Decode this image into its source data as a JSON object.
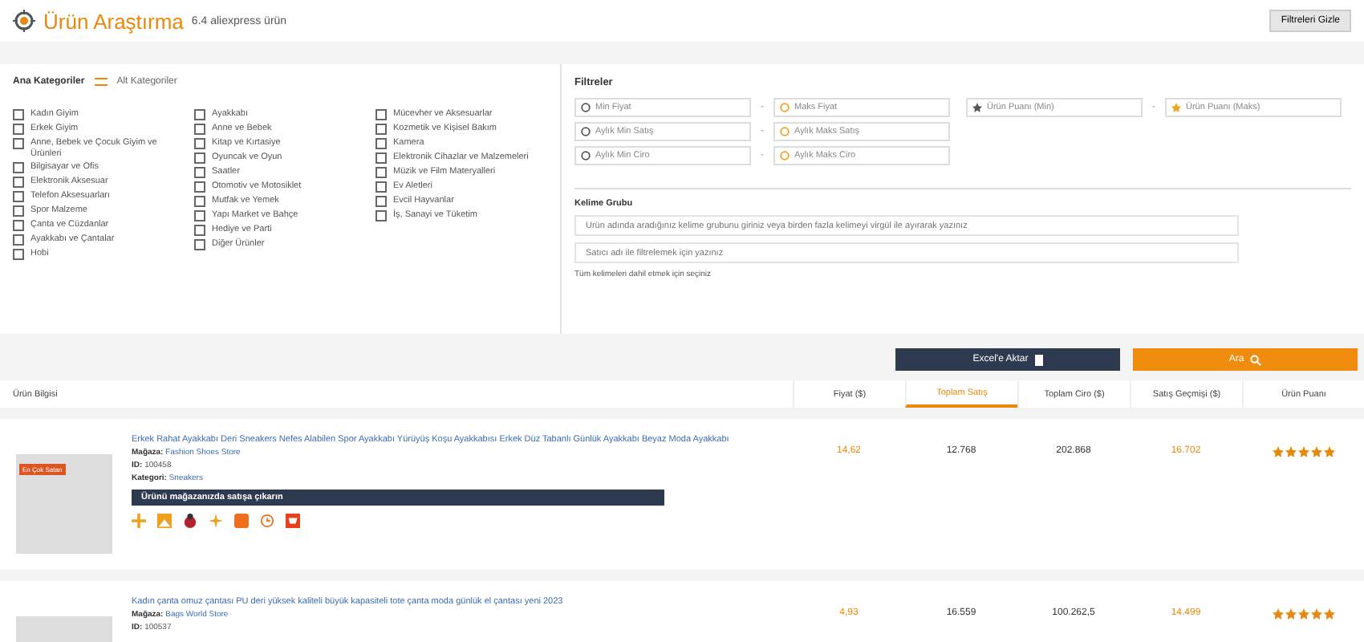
{
  "header": {
    "title": "Ürün Araştırma",
    "subtitle": "6.4 aliexpress ürün",
    "toggle_button": "Filtreleri Gizle"
  },
  "categories": {
    "main_label": "Ana Kategoriler",
    "sub_label": "Alt Kategoriler",
    "columns": [
      [
        {
          "label": "Kadın Giyim",
          "checked": false
        },
        {
          "label": "Erkek Giyim",
          "checked": false
        },
        {
          "label": "Anne, Bebek ve Çocuk Giyim ve Ürünleri",
          "checked": false
        },
        {
          "label": "Bilgisayar ve Ofis",
          "checked": false
        },
        {
          "label": "Elektronik Aksesuar",
          "checked": false
        },
        {
          "label": "Telefon Aksesuarları",
          "checked": false
        },
        {
          "label": "Spor Malzeme",
          "checked": false
        },
        {
          "label": "Çanta ve Cüzdanlar",
          "checked": false
        },
        {
          "label": "Ayakkabı ve Çantalar",
          "checked": false
        },
        {
          "label": "Hobi",
          "checked": false
        }
      ],
      [
        {
          "label": "Ayakkabı",
          "checked": false
        },
        {
          "label": "Anne ve Bebek",
          "checked": false
        },
        {
          "label": "Kitap ve Kırtasiye",
          "checked": false
        },
        {
          "label": "Oyuncak ve Oyun",
          "checked": false
        },
        {
          "label": "Saatler",
          "checked": false
        },
        {
          "label": "Otomotiv ve Motosiklet",
          "checked": false
        },
        {
          "label": "Mutfak ve Yemek",
          "checked": false
        },
        {
          "label": "Yapı Market ve Bahçe",
          "checked": false
        },
        {
          "label": "Hediye ve Parti",
          "checked": false
        },
        {
          "label": "Diğer Ürünler",
          "checked": false
        }
      ],
      [
        {
          "label": "Mücevher ve Aksesuarlar",
          "checked": false
        },
        {
          "label": "Kozmetik ve Kişisel Bakım",
          "checked": false
        },
        {
          "label": "Kamera",
          "checked": false
        },
        {
          "label": "Elektronik Cihazlar ve Malzemeleri",
          "checked": false
        },
        {
          "label": "Müzik ve Film Materyalleri",
          "checked": false
        },
        {
          "label": "Ev Aletleri",
          "checked": false
        },
        {
          "label": "Evcil Hayvanlar",
          "checked": false
        },
        {
          "label": "İş, Sanayi ve Tüketim",
          "checked": false
        }
      ]
    ]
  },
  "filters": {
    "title": "Filtreler",
    "ranges": [
      {
        "min": "Min Fiyat",
        "max": "Maks Fiyat"
      },
      {
        "min": "Aylık Min Satış",
        "max": "Aylık Maks Satış"
      },
      {
        "min": "Aylık Min Ciro",
        "max": "Aylık Maks Ciro"
      }
    ],
    "rating": {
      "min": "Ürün Puanı (Min)",
      "max": "Ürün Puanı (Maks)"
    },
    "separator": "-",
    "keyword_label": "Kelime Grubu",
    "keyword_placeholder": "Ürün adında aradığınız kelime grubunu giriniz veya birden fazla kelimeyi virgül ile ayırarak yazınız",
    "seller_placeholder": "Satıcı adı ile filtrelemek için yazınız",
    "hint": "Tüm kelimeleri dahil etmek için seçiniz"
  },
  "actions": {
    "export": "Excel'e Aktar",
    "search": "Ara"
  },
  "table": {
    "columns": [
      {
        "label": "Ürün Bilgisi",
        "selected": false
      },
      {
        "label": "Fiyat ($)",
        "selected": false
      },
      {
        "label": "Toplam Satış",
        "selected": true
      },
      {
        "label": "Toplam Ciro ($)",
        "selected": false
      },
      {
        "label": "Satış Geçmişi ($)",
        "selected": false
      },
      {
        "label": "Ürün Puanı",
        "selected": false
      }
    ],
    "rows": [
      {
        "title": "Erkek Rahat Ayakkabı Deri Sneakers Nefes Alabilen Spor Ayakkabı Yürüyüş Koşu Ayakkabısı Erkek Düz Tabanlı Günlük Ayakkabı Beyaz Moda Ayakkabı",
        "store_label": "Mağaza:",
        "store": "Fashion Shoes Store",
        "id_label": "ID:",
        "id": "100458",
        "category_label": "Kategori:",
        "category": "Sneakers",
        "badge": "En Çok Satan",
        "sell_bar": "Ürünü mağazanızda satışa çıkarın",
        "price": "14,62",
        "sales": "12.768",
        "revenue": "202.868",
        "history": "16.702",
        "stars": 5
      },
      {
        "title": "Kadın çanta omuz çantası PU deri yüksek kaliteli büyük kapasiteli tote çanta moda günlük el çantası yeni 2023",
        "store_label": "Mağaza:",
        "store": "Bags World Store",
        "id_label": "ID:",
        "id": "100537",
        "badge": "",
        "sell_bar": "",
        "price": "4,93",
        "sales": "16.559",
        "revenue": "100.262,5",
        "history": "14.499",
        "stars": 5
      }
    ]
  }
}
